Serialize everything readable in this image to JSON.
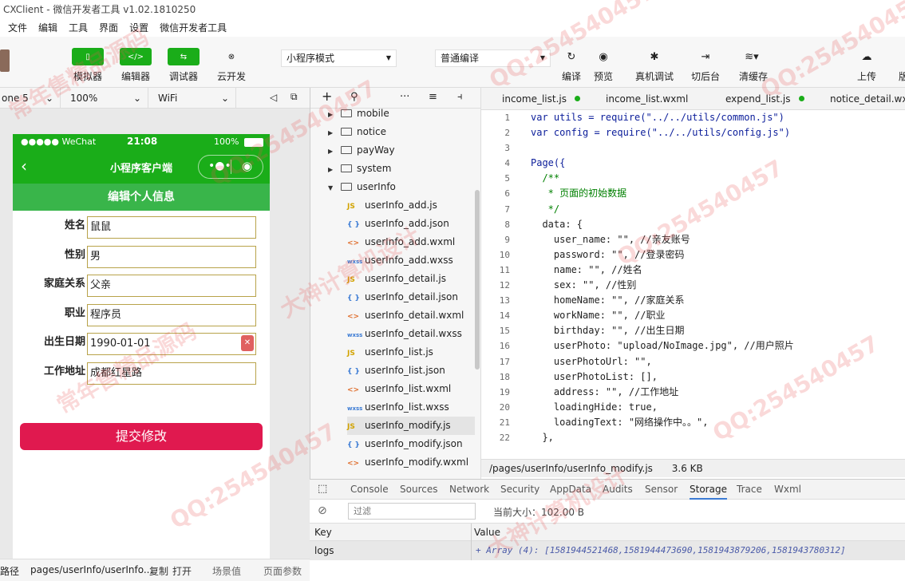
{
  "window": {
    "title": "CXClient - 微信开发者工具 v1.02.1810250"
  },
  "menu": [
    "文件",
    "编辑",
    "工具",
    "界面",
    "设置",
    "微信开发者工具"
  ],
  "toolbar": {
    "simulator": "模拟器",
    "editor": "编辑器",
    "debugger": "调试器",
    "cloud": "云开发",
    "mode": "小程序模式",
    "compile_mode": "普通编译",
    "compile": "编译",
    "preview": "预览",
    "real_debug": "真机调试",
    "background": "切后台",
    "clear_cache": "清缓存",
    "upload": "上传",
    "version": "版"
  },
  "simbar": {
    "device": "one 5",
    "zoom": "100%",
    "network": "WiFi"
  },
  "phone": {
    "carrier": "●●●●● WeChat",
    "time": "21:08",
    "battery": "100%",
    "nav_title": "小程序客户端",
    "section_title": "编辑个人信息",
    "fields": [
      {
        "label": "姓名：",
        "value": "鼠鼠"
      },
      {
        "label": "性别：",
        "value": "男"
      },
      {
        "label": "家庭关系：",
        "value": "父亲"
      },
      {
        "label": "职业：",
        "value": "程序员"
      },
      {
        "label": "出生日期：",
        "value": "1990-01-01"
      },
      {
        "label": "工作地址：",
        "value": "成都红星路"
      }
    ],
    "submit": "提交修改"
  },
  "filetree": {
    "folders": [
      "mobile",
      "notice",
      "payWay",
      "system",
      "userInfo"
    ],
    "files": [
      {
        "name": "userInfo_add.js",
        "type": "js"
      },
      {
        "name": "userInfo_add.json",
        "type": "json"
      },
      {
        "name": "userInfo_add.wxml",
        "type": "wxml"
      },
      {
        "name": "userInfo_add.wxss",
        "type": "wxss"
      },
      {
        "name": "userInfo_detail.js",
        "type": "js"
      },
      {
        "name": "userInfo_detail.json",
        "type": "json"
      },
      {
        "name": "userInfo_detail.wxml",
        "type": "wxml"
      },
      {
        "name": "userInfo_detail.wxss",
        "type": "wxss"
      },
      {
        "name": "userInfo_list.js",
        "type": "js"
      },
      {
        "name": "userInfo_list.json",
        "type": "json"
      },
      {
        "name": "userInfo_list.wxml",
        "type": "wxml"
      },
      {
        "name": "userInfo_list.wxss",
        "type": "wxss"
      },
      {
        "name": "userInfo_modify.js",
        "type": "js"
      },
      {
        "name": "userInfo_modify.json",
        "type": "json"
      },
      {
        "name": "userInfo_modify.wxml",
        "type": "wxml"
      }
    ]
  },
  "editor": {
    "tabs": [
      "income_list.js",
      "income_list.wxml",
      "expend_list.js",
      "notice_detail.wx"
    ],
    "lines": [
      "var utils = require(\"../../utils/common.js\")",
      "var config = require(\"../../utils/config.js\")",
      "",
      "Page({",
      "  /**",
      "   * 页面的初始数据",
      "   */",
      "  data: {",
      "    user_name: \"\", //亲友账号",
      "    password: \"\", //登录密码",
      "    name: \"\", //姓名",
      "    sex: \"\", //性别",
      "    homeName: \"\", //家庭关系",
      "    workName: \"\", //职业",
      "    birthday: \"\", //出生日期",
      "    userPhoto: \"upload/NoImage.jpg\", //用户照片",
      "    userPhotoUrl: \"\",",
      "    userPhotoList: [],",
      "    address: \"\", //工作地址",
      "    loadingHide: true,",
      "    loadingText: \"网络操作中。。\",",
      "  },"
    ],
    "line_numbers": [
      "1",
      "2",
      "3",
      "4",
      "5",
      "6",
      "7",
      "8",
      "9",
      "10",
      "11",
      "12",
      "13",
      "14",
      "15",
      "16",
      "17",
      "18",
      "19",
      "20",
      "21",
      "22"
    ],
    "path": "/pages/userInfo/userInfo_modify.js",
    "size": "3.6 KB"
  },
  "devtools": {
    "tabs": [
      "Console",
      "Sources",
      "Network",
      "Security",
      "AppData",
      "Audits",
      "Sensor",
      "Storage",
      "Trace",
      "Wxml"
    ],
    "active": "Storage",
    "filter_placeholder": "过滤",
    "current_size": "当前大小：102.00 B",
    "col_key": "Key",
    "col_value": "Value",
    "row_key": "logs",
    "row_value": "+ Array (4): [1581944521468,1581944473690,1581943879206,1581943780312]"
  },
  "bottombar": {
    "label": "路径",
    "path": "pages/userInfo/userInfo...",
    "copy": "复制",
    "open": "打开",
    "scene": "场景值",
    "params": "页面参数"
  },
  "watermarks": [
    "QQ:254540457",
    "大神计算机设计",
    "常年售精品源码"
  ]
}
